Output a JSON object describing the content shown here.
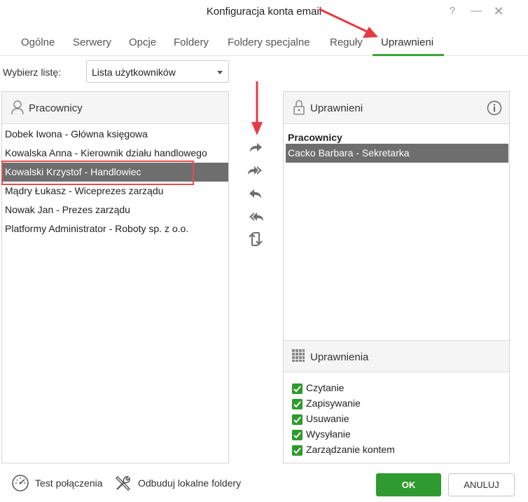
{
  "window": {
    "title": "Konfiguracja konta email",
    "help": "?",
    "minimize": "—",
    "close": "✕"
  },
  "tabs": [
    {
      "label": "Ogólne"
    },
    {
      "label": "Serwery"
    },
    {
      "label": "Opcje"
    },
    {
      "label": "Foldery"
    },
    {
      "label": "Foldery specjalne"
    },
    {
      "label": "Reguły"
    },
    {
      "label": "Uprawnieni",
      "active": true
    }
  ],
  "list_select": {
    "label": "Wybierz listę:",
    "value": "Lista użytkowników"
  },
  "left_panel": {
    "title": "Pracownicy",
    "items": [
      {
        "label": "Dobek Iwona - Główna księgowa"
      },
      {
        "label": "Kowalska Anna - Kierownik działu handlowego"
      },
      {
        "label": "Kowalski Krzystof - Handlowiec",
        "selected": true
      },
      {
        "label": "Mądry Łukasz - Wiceprezes zarządu"
      },
      {
        "label": "Nowak Jan - Prezes zarządu"
      },
      {
        "label": "Platformy Administrator - Roboty sp. z o.o."
      }
    ]
  },
  "transfer_buttons": [
    {
      "icon": "arrow-right-icon"
    },
    {
      "icon": "double-arrow-right-icon"
    },
    {
      "icon": "arrow-left-icon"
    },
    {
      "icon": "double-arrow-left-icon"
    },
    {
      "icon": "swap-icon"
    }
  ],
  "right_panel": {
    "title": "Uprawnieni",
    "group": "Pracownicy",
    "items": [
      {
        "label": "Cacko Barbara - Sekretarka",
        "selected": true
      }
    ]
  },
  "permissions": {
    "title": "Uprawnienia",
    "items": [
      {
        "label": "Czytanie",
        "checked": true
      },
      {
        "label": "Zapisywanie",
        "checked": true
      },
      {
        "label": "Usuwanie",
        "checked": true
      },
      {
        "label": "Wysyłanie",
        "checked": true
      },
      {
        "label": "Zarządzanie kontem",
        "checked": true
      }
    ]
  },
  "footer": {
    "test_connection": "Test połączenia",
    "rebuild_folders": "Odbuduj lokalne foldery",
    "ok": "OK",
    "cancel": "ANULUJ"
  },
  "colors": {
    "accent_green": "#2f9a2f",
    "selection_gray": "#6e6e6e",
    "annotation_red": "#e63946"
  }
}
